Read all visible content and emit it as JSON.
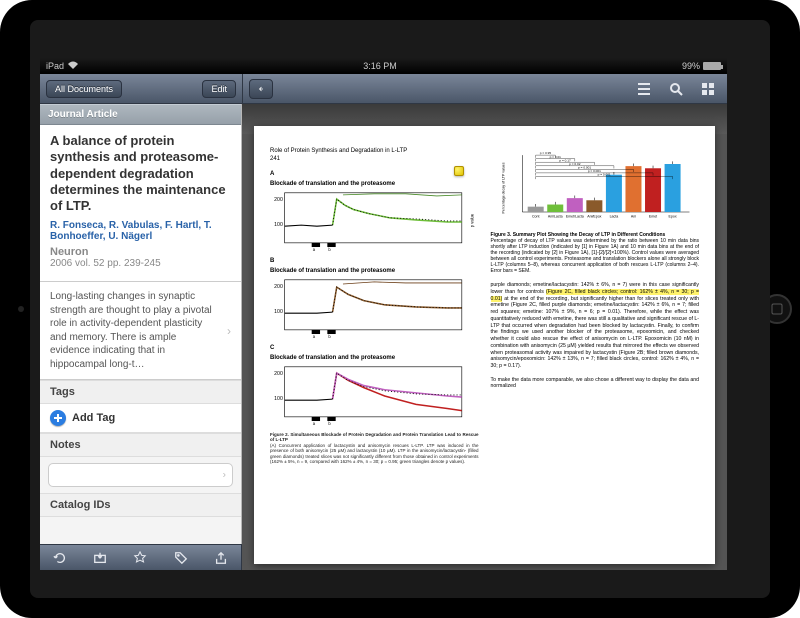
{
  "status": {
    "carrier": "iPad",
    "time": "3:16 PM",
    "battery_pct": "99%"
  },
  "toolbar": {
    "all_docs": "All Documents",
    "edit": "Edit"
  },
  "section": {
    "header": "Journal Article"
  },
  "article": {
    "title": "A balance of protein synthesis and proteasome-dependent degradation determines the maintenance of LTP.",
    "authors": "R. Fonseca, R. Vabulas, F. Hartl, T. Bonhoeffer, U. Nägerl",
    "journal": "Neuron",
    "meta": "2006 vol. 52 pp. 239-245",
    "abstract": "Long-lasting changes in synaptic strength are thought to play a pivotal role in activity-dependent plasticity and memory. There is ample evidence indicating that in hippocampal long-t…"
  },
  "tags": {
    "header": "Tags",
    "add": "Add Tag"
  },
  "notes": {
    "header": "Notes"
  },
  "catalog": {
    "header": "Catalog IDs"
  },
  "paper": {
    "running_head": "Role of Protein Synthesis and Degradation in L-LTP",
    "page_no": "241",
    "panel_a": "Blockade of translation and the proteasome",
    "panel_b": "Blockade of translation and the proteasome",
    "panel_c": "Blockade of translation and the proteasome",
    "xlabel_a_b": "a    b",
    "fig2_caption_title": "Figure 2. Simultaneous Blockade of Protein Degradation and Protein Translation Lead to Rescue of L-LTP",
    "fig2_caption_body": "(A) Concurrent application of lactacystin and anisomycin rescues L-LTP. LTP was induced in the presence of both anisomycin (25 µM) and lactacystin (10 µM). LTP in the anisomycin/lactacystin- (filled green diamonds) treated slices was not significantly different from those obtained in control experiments (162% ± 5%, n = 9, compared with 162% ± 4%, n = 30; p = 0.95; green triangles denote p values).",
    "fig3_title": "Figure 3. Summary Plot Showing the Decay of LTP in Different Conditions",
    "fig3_body": "Percentage of decay of LTP values was determined by the ratio between 10 min data bins shortly after LTP induction (indicated by [1] in Figure 1A) and 10 min data bins at the end of the recording (indicated by [2] in Figure 1A), [1]-[2]/[2]×100%). Control values were averaged between all control experiments. Proteasome and translation blockers alone all strongly block L-LTP (columns 5–8), whereas concurrent application of both rescues L-LTP (columns 2–4). Error bars = SEM.",
    "body_text_1": "purple diamonds; emetine/lactacystin: 142% ± 6%, n = 7) were in this case significantly lower than for controls ",
    "body_text_hl": "(Figure 2C, filled black circles; control: 162% ± 4%, n = 30; p = 0.01)",
    "body_text_2": " at the end of the recording, but significantly higher than for slices treated only with emetine (Figure 2C, filled purple diamonds; emetine/lactacystin: 142% ± 6%, n = 7; filled red squares; emetine: 107% ± 9%, n = 6; p = 0.01). Therefore, while the effect was quantitatively reduced with emetine, there was still a qualitative and significant rescue of L-LTP that occurred when degradation had been blocked by lactacystin. Finally, to confirm the findings we used another blocker of the proteasome, epoxomicin, and checked whether it could also rescue the effect of anisomycin on L-LTP. Epoxomicin (10 nM) in combination with anisomycin (25 µM) yielded results that mirrored the effects we observed when proteasomal activity was impaired by lactacystin (Figure 2B; filled brown diamonds, anisomycin/epoxomicin: 142% ± 13%, n = 7; filled black circles, control: 162% ± 4%, n = 30; p = 0.17).",
    "body_text_3": "To make the data more comparable, we also chose a different way to display the data and normalized"
  },
  "chart_data": {
    "type": "bar",
    "title": "Summary plot — Percentage decay of LTP values",
    "categories": [
      "Cont",
      "Ani/Lacta",
      "Emet/Lacta",
      "Ani/Epox",
      "Lacta",
      "Ani",
      "Emet",
      "Epox"
    ],
    "values": [
      10,
      14,
      26,
      22,
      70,
      86,
      82,
      90
    ],
    "p_values": [
      null,
      0.95,
      0.01,
      0.17,
      0.02,
      0.001,
      0.001,
      0.001
    ],
    "colors": [
      "#999999",
      "#6fbf3a",
      "#c060c0",
      "#8a5a2b",
      "#2aa0e0",
      "#e07030",
      "#c02020",
      "#2aa0e0"
    ],
    "ylabel": "Percentage decay of LTP values",
    "ylim": [
      0,
      100
    ]
  }
}
